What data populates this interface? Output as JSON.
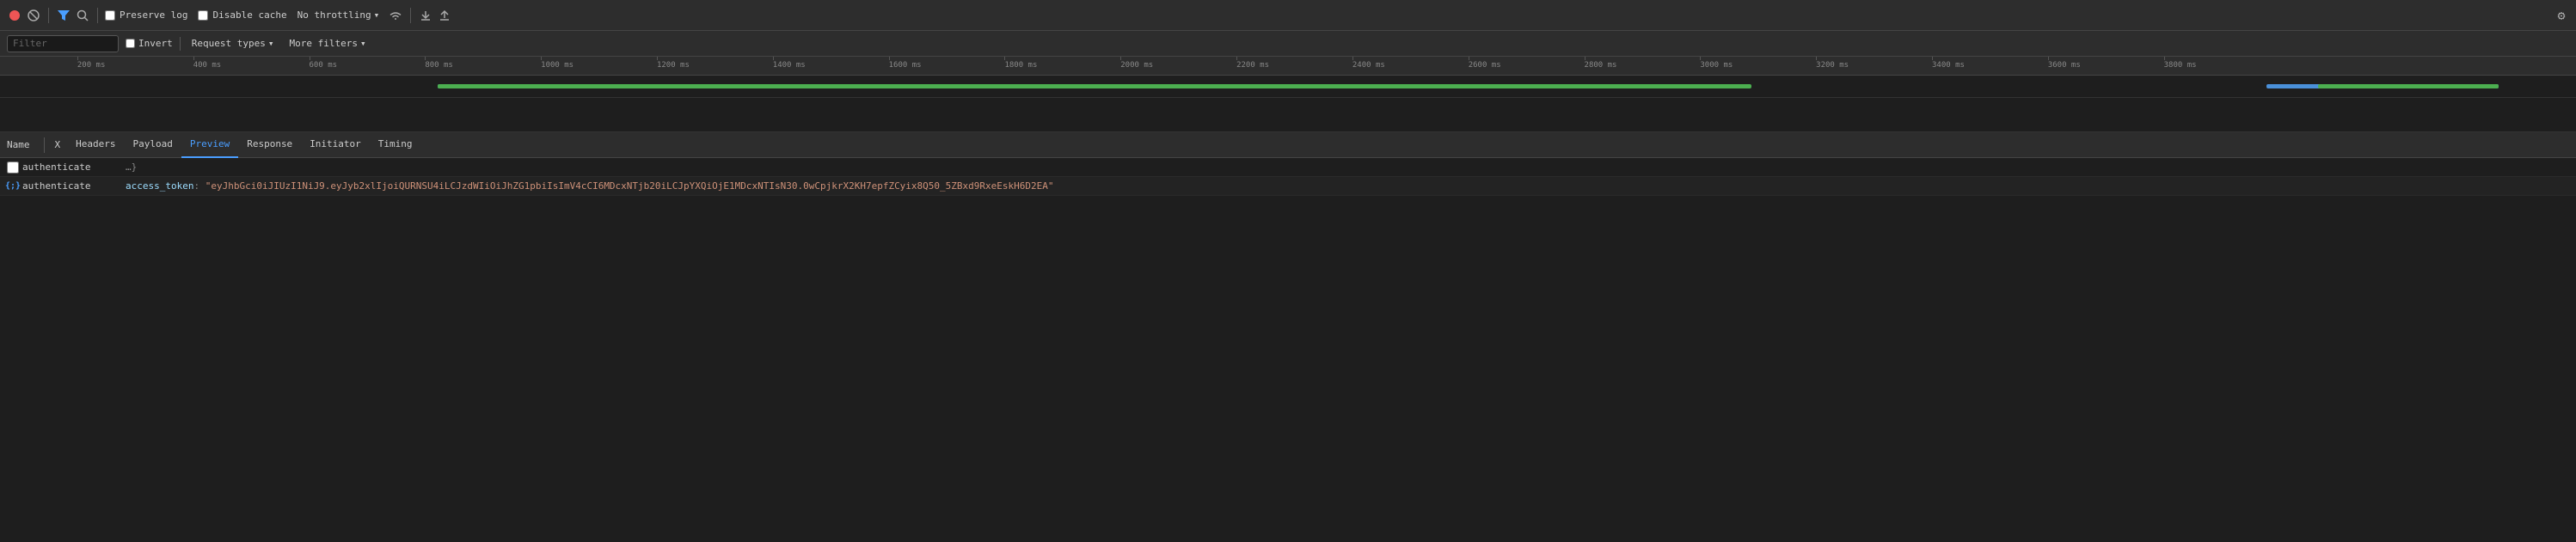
{
  "toolbar": {
    "record_label": "Record",
    "stop_label": "Stop",
    "filter_label": "Filter",
    "search_label": "Search",
    "preserve_log_label": "Preserve log",
    "disable_cache_label": "Disable cache",
    "no_throttling_label": "No throttling",
    "settings_label": "Settings",
    "preserve_log_checked": false,
    "disable_cache_checked": false
  },
  "filter_bar": {
    "filter_placeholder": "Filter",
    "invert_label": "Invert",
    "invert_checked": false,
    "request_types_label": "Request types",
    "more_filters_label": "More filters"
  },
  "timeline": {
    "ticks": [
      "200 ms",
      "400 ms",
      "600 ms",
      "800 ms",
      "1000 ms",
      "1200 ms",
      "1400 ms",
      "1600 ms",
      "1800 ms",
      "2000 ms",
      "2200 ms",
      "2400 ms",
      "2600 ms",
      "2800 ms",
      "3000 ms",
      "3200 ms",
      "3400 ms",
      "3600 ms",
      "3800 ms"
    ]
  },
  "tabs": {
    "name_col": "Name",
    "x_col": "X",
    "headers_tab": "Headers",
    "payload_tab": "Payload",
    "preview_tab": "Preview",
    "response_tab": "Response",
    "initiator_tab": "Initiator",
    "timing_tab": "Timing",
    "active_tab": "preview"
  },
  "rows": [
    {
      "type": "checkbox",
      "icon": "",
      "name": "authenticate",
      "content": "…}"
    },
    {
      "type": "json",
      "icon": "{;}",
      "name": "authenticate",
      "content": "access_token: \"eyJhbGci0iJIUzI1NiJ9.eyJyb2xlIjoiQURNSU4iLCJzdWIiOiJhZG1pbiIsImV4cCI6MDcxNTjb20iLCJpYXQiOjE1MDcxNTIsN30.0wCpjkrX2KH7epfZCyix8Q50_5ZBxd9RxeEskH6D2EA\""
    }
  ],
  "icons": {
    "record": "⏺",
    "stop": "⊘",
    "filter": "▼",
    "search": "🔍",
    "wifi": "⌘",
    "upload": "⬆",
    "download": "⬇",
    "gear": "⚙",
    "chevron_down": "▾",
    "json": "{;}"
  }
}
